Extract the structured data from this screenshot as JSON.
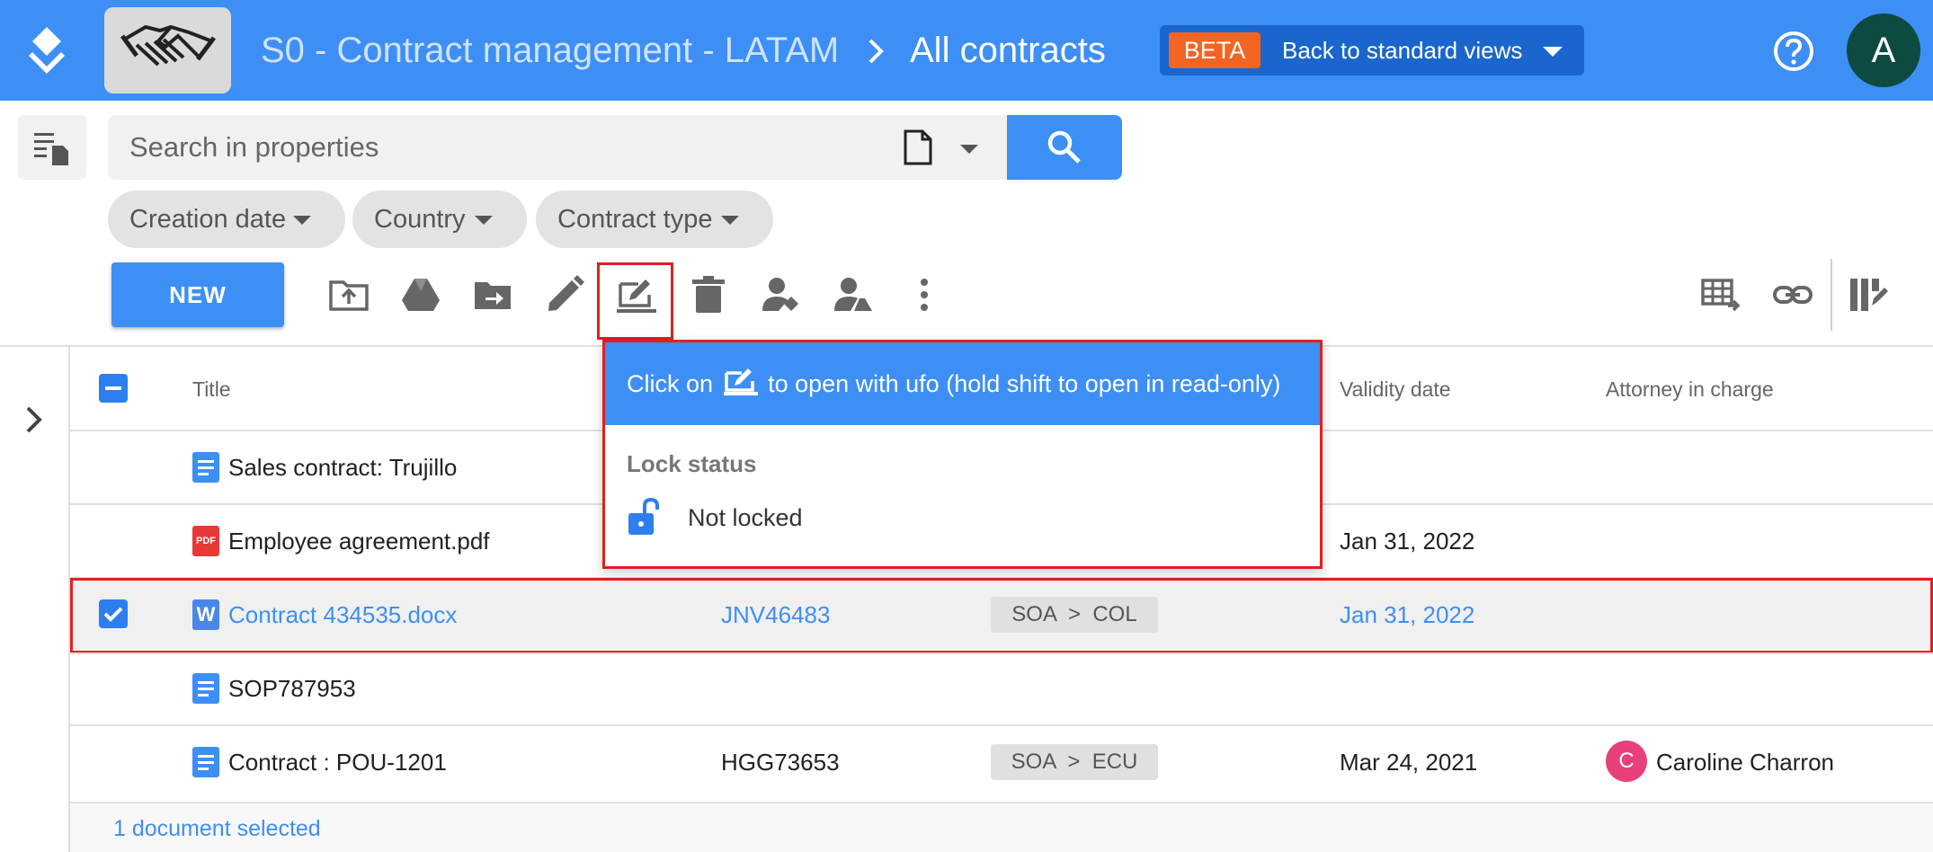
{
  "colors": {
    "primary": "#3d8ff5",
    "beta": "#f26522",
    "highlight": "#e02020",
    "avatar": "#0d4a3f",
    "attorney_avatar": "#e8407a"
  },
  "header": {
    "breadcrumb_space": "S0 - Contract management - LATAM",
    "breadcrumb_view": "All contracts",
    "beta_tag": "BETA",
    "beta_action": "Back to standard views",
    "avatar_initial": "A"
  },
  "search": {
    "placeholder": "Search in properties"
  },
  "filters": [
    "Creation date",
    "Country",
    "Contract type"
  ],
  "toolbar": {
    "new_label": "NEW",
    "icons": [
      "upload-icon",
      "drive-icon",
      "move-icon",
      "edit-icon",
      "open-with-ufo-icon",
      "delete-icon",
      "assign-user-icon",
      "share-drive-icon",
      "more-vert-icon",
      "export-table-icon",
      "link-icon",
      "column-settings-icon"
    ]
  },
  "table": {
    "columns": {
      "title": "Title",
      "validity": "Validity date",
      "attorney": "Attorney in charge"
    },
    "rows": [
      {
        "title": "Sales contract: Trujillo",
        "type": "gdoc",
        "ref": "",
        "chip": "",
        "validity": "",
        "attorney": ""
      },
      {
        "title": "Employee agreement.pdf",
        "type": "pdf",
        "ref": "",
        "chip": "",
        "validity": "Jan 31, 2022",
        "attorney": ""
      },
      {
        "title": "Contract 434535.docx",
        "type": "word",
        "ref": "JNV46483",
        "chip": "SOA  >  COL",
        "validity": "Jan 31, 2022",
        "attorney": "",
        "selected": true
      },
      {
        "title": "SOP787953",
        "type": "gdoc",
        "ref": "",
        "chip": "",
        "validity": "",
        "attorney": ""
      },
      {
        "title": "Contract : POU-1201",
        "type": "gdoc",
        "ref": "HGG73653",
        "chip": "SOA  >  ECU",
        "validity": "Mar 24, 2021",
        "attorney": "Caroline Charron",
        "attorney_initial": "C"
      }
    ],
    "pdf_badge": "PDF",
    "word_badge": "W"
  },
  "footer": {
    "selection_text": "1 document selected"
  },
  "tooltip": {
    "text_before": "Click on",
    "text_after": "to open with ufo (hold shift to open in read-only)",
    "lock_title": "Lock status",
    "lock_value": "Not locked"
  }
}
